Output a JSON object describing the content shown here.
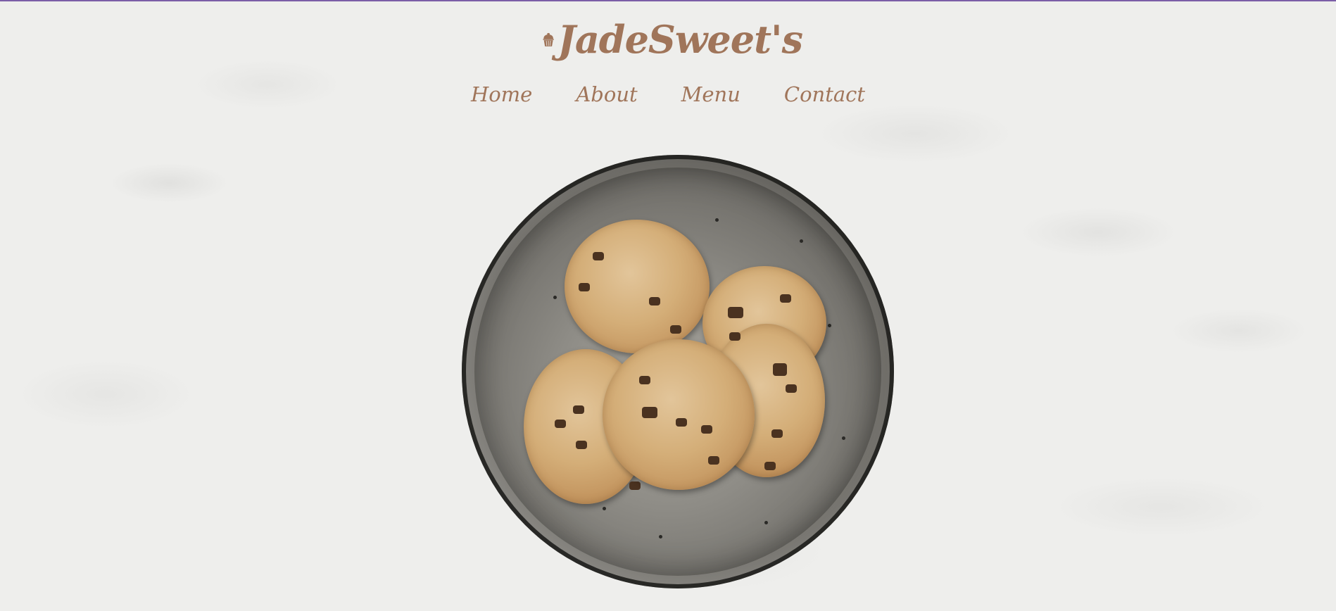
{
  "site": {
    "brand_name": "JadeSweet's",
    "logo_icon": "cupcake-icon"
  },
  "nav": {
    "items": [
      {
        "label": "Home"
      },
      {
        "label": "About"
      },
      {
        "label": "Menu"
      },
      {
        "label": "Contact"
      }
    ]
  },
  "hero": {
    "image": "plate-of-chocolate-chip-cookies"
  },
  "colors": {
    "brand": "#a0755a",
    "background": "#eeeeec",
    "top_rule": "#7b5ea7"
  }
}
